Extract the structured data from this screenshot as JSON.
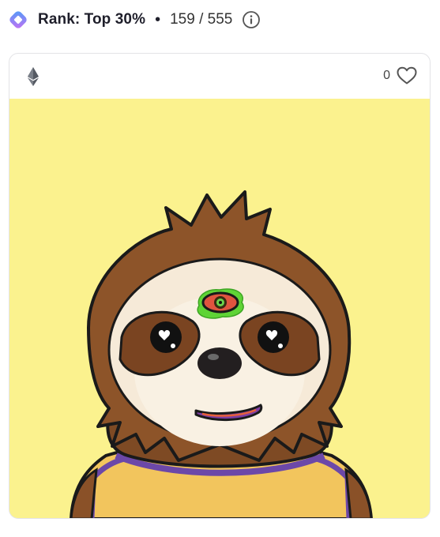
{
  "rank": {
    "label": "Rank: Top 30%",
    "separator": "•",
    "position": "159 / 555",
    "logo_icon": "rarity-diamond-icon",
    "info_icon": "info-circle-icon",
    "logo_colors": [
      "#5b8cf7",
      "#c86ff5"
    ]
  },
  "card": {
    "chain_icon": "ethereum-icon",
    "likes_count": "0",
    "like_icon": "heart-outline-icon",
    "artwork": {
      "subject": "sloth-with-third-eye",
      "background_color": "#fbf28e"
    }
  }
}
